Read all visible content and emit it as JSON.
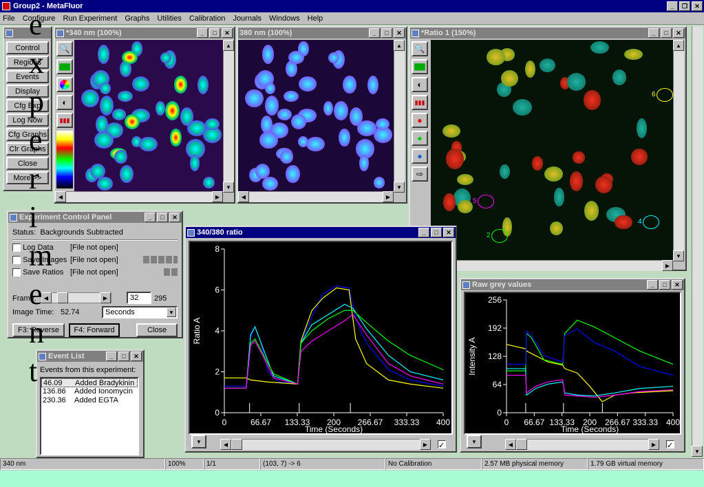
{
  "app": {
    "title": "Group2 - MetaFluor"
  },
  "menu": [
    "File",
    "Configure",
    "Run Experiment",
    "Graphs",
    "Utilities",
    "Calibration",
    "Journals",
    "Windows",
    "Help"
  ],
  "sidebar": {
    "buttons": [
      "Control",
      "Regions",
      "Events",
      "Display",
      "Cfg Exp",
      "Log Now",
      "Cfg Graphs",
      "Clr Graphs",
      "Close",
      "More >>"
    ]
  },
  "img340": {
    "title": "*340 nm (100%)"
  },
  "img380": {
    "title": "380 nm (100%)"
  },
  "ratio": {
    "title": "*Ratio 1 (150%)",
    "regions": [
      "6",
      "5",
      "2",
      "4"
    ]
  },
  "ecp": {
    "title": "Experiment Control Panel",
    "status_label": "Status:",
    "status_value": "Backgrounds Subtracted",
    "log_data": "Log Data",
    "save_images": "Save Images",
    "save_ratios": "Save Ratios",
    "file_not_open": "[File not open]",
    "frame_label": "Frame:",
    "frame_value": "32",
    "frame_total": "295",
    "image_time_label": "Image Time:",
    "image_time_value": "52.74",
    "units": "Seconds",
    "reverse": "F3: Reverse",
    "forward": "F4: Forward",
    "close": "Close"
  },
  "events": {
    "title": "Event List",
    "header": "Events from this experiment:",
    "items": [
      {
        "t": "46.09",
        "label": "Added Bradykinin"
      },
      {
        "t": "136.86",
        "label": "Added Ionomycin"
      },
      {
        "t": "230.36",
        "label": "Added EGTA"
      }
    ]
  },
  "overlay_letters": [
    "e",
    "x",
    "p",
    "e",
    "r",
    "i",
    "m",
    "e",
    "n",
    "t"
  ],
  "status": {
    "wavelength": "340 nm",
    "zoom": "100%",
    "page": "1/1",
    "coord": "(103, 7) -> 6",
    "calibration": "No Calibration",
    "physical": "2.57 MB physical memory",
    "virtual": "1.79 GB virtual memory"
  },
  "chart_data": [
    {
      "type": "line",
      "title": "340/380 ratio",
      "xlabel": "Time (Seconds)",
      "ylabel": "Ratio A",
      "xlim": [
        0,
        400
      ],
      "ylim": [
        0,
        8
      ],
      "xticks": [
        "0",
        "66.67",
        "133.33",
        "200",
        "266.67",
        "333.33",
        "400"
      ],
      "yticks": [
        "0",
        "2",
        "4",
        "6",
        "8"
      ],
      "event_times": [
        46.09,
        136.86,
        230.36
      ],
      "series": [
        {
          "color": "#0000ff",
          "points": [
            [
              0,
              1.3
            ],
            [
              40,
              1.3
            ],
            [
              48,
              3.7
            ],
            [
              56,
              4.2
            ],
            [
              66,
              3.5
            ],
            [
              80,
              2.0
            ],
            [
              100,
              1.5
            ],
            [
              134,
              1.4
            ],
            [
              140,
              3.4
            ],
            [
              160,
              4.7
            ],
            [
              180,
              5.8
            ],
            [
              205,
              6.2
            ],
            [
              228,
              6.1
            ],
            [
              240,
              4.6
            ],
            [
              260,
              3.4
            ],
            [
              300,
              2.1
            ],
            [
              340,
              1.6
            ],
            [
              400,
              1.3
            ]
          ]
        },
        {
          "color": "#ffff00",
          "points": [
            [
              0,
              1.7
            ],
            [
              40,
              1.7
            ],
            [
              48,
              1.6
            ],
            [
              80,
              1.5
            ],
            [
              134,
              1.4
            ],
            [
              140,
              3.5
            ],
            [
              160,
              5.0
            ],
            [
              180,
              5.6
            ],
            [
              205,
              6.1
            ],
            [
              228,
              6.0
            ],
            [
              240,
              3.6
            ],
            [
              260,
              2.4
            ],
            [
              300,
              1.6
            ],
            [
              340,
              1.4
            ],
            [
              400,
              1.2
            ]
          ]
        },
        {
          "color": "#00ffff",
          "points": [
            [
              0,
              1.2
            ],
            [
              40,
              1.2
            ],
            [
              48,
              3.8
            ],
            [
              56,
              4.2
            ],
            [
              70,
              3.2
            ],
            [
              90,
              1.8
            ],
            [
              134,
              1.4
            ],
            [
              140,
              3.4
            ],
            [
              160,
              4.3
            ],
            [
              190,
              4.8
            ],
            [
              220,
              5.3
            ],
            [
              235,
              5.1
            ],
            [
              260,
              4.1
            ],
            [
              300,
              2.8
            ],
            [
              340,
              2.0
            ],
            [
              400,
              1.6
            ]
          ]
        },
        {
          "color": "#00ff00",
          "points": [
            [
              0,
              1.2
            ],
            [
              40,
              1.2
            ],
            [
              48,
              3.4
            ],
            [
              56,
              3.6
            ],
            [
              70,
              2.9
            ],
            [
              90,
              1.9
            ],
            [
              134,
              1.4
            ],
            [
              140,
              3.4
            ],
            [
              160,
              4.0
            ],
            [
              190,
              4.6
            ],
            [
              220,
              5.0
            ],
            [
              235,
              5.0
            ],
            [
              260,
              4.4
            ],
            [
              300,
              3.5
            ],
            [
              340,
              2.8
            ],
            [
              400,
              2.1
            ]
          ]
        },
        {
          "color": "#ff00ff",
          "points": [
            [
              0,
              1.2
            ],
            [
              40,
              1.2
            ],
            [
              48,
              3.3
            ],
            [
              56,
              3.5
            ],
            [
              70,
              2.8
            ],
            [
              90,
              1.7
            ],
            [
              134,
              1.4
            ],
            [
              140,
              3.0
            ],
            [
              160,
              3.5
            ],
            [
              190,
              4.0
            ],
            [
              220,
              4.5
            ],
            [
              235,
              4.8
            ],
            [
              260,
              3.8
            ],
            [
              300,
              2.4
            ],
            [
              340,
              1.8
            ],
            [
              400,
              1.4
            ]
          ]
        }
      ]
    },
    {
      "type": "line",
      "title": "Raw grey values",
      "xlabel": "Time (Seconds)",
      "ylabel": "Intensity A",
      "xlim": [
        0,
        400
      ],
      "ylim": [
        0,
        256
      ],
      "xticks": [
        "0",
        "66.67",
        "133.33",
        "200",
        "266.67",
        "333.33",
        "400"
      ],
      "yticks": [
        "0",
        "64",
        "128",
        "192",
        "256"
      ],
      "event_times": [
        46.09,
        136.86,
        230.36
      ],
      "series": [
        {
          "color": "#ffff00",
          "points": [
            [
              0,
              155
            ],
            [
              46,
              145
            ],
            [
              48,
              140
            ],
            [
              100,
              115
            ],
            [
              135,
              108
            ],
            [
              140,
              100
            ],
            [
              170,
              90
            ],
            [
              200,
              60
            ],
            [
              230,
              25
            ],
            [
              260,
              40
            ],
            [
              300,
              45
            ],
            [
              400,
              50
            ]
          ]
        },
        {
          "color": "#00ff00",
          "points": [
            [
              0,
              95
            ],
            [
              46,
              95
            ],
            [
              48,
              180
            ],
            [
              60,
              170
            ],
            [
              90,
              120
            ],
            [
              135,
              110
            ],
            [
              140,
              180
            ],
            [
              170,
              210
            ],
            [
              210,
              195
            ],
            [
              260,
              170
            ],
            [
              320,
              140
            ],
            [
              400,
              110
            ]
          ]
        },
        {
          "color": "#0000ff",
          "points": [
            [
              0,
              110
            ],
            [
              46,
              110
            ],
            [
              48,
              185
            ],
            [
              60,
              175
            ],
            [
              90,
              130
            ],
            [
              135,
              115
            ],
            [
              140,
              175
            ],
            [
              170,
              190
            ],
            [
              210,
              160
            ],
            [
              260,
              140
            ],
            [
              320,
              105
            ],
            [
              400,
              85
            ]
          ]
        },
        {
          "color": "#00ffff",
          "points": [
            [
              0,
              100
            ],
            [
              46,
              100
            ],
            [
              48,
              40
            ],
            [
              70,
              55
            ],
            [
              100,
              65
            ],
            [
              135,
              70
            ],
            [
              140,
              45
            ],
            [
              170,
              40
            ],
            [
              210,
              38
            ],
            [
              260,
              45
            ],
            [
              320,
              55
            ],
            [
              400,
              60
            ]
          ]
        },
        {
          "color": "#ff00ff",
          "points": [
            [
              0,
              85
            ],
            [
              46,
              85
            ],
            [
              48,
              45
            ],
            [
              70,
              60
            ],
            [
              100,
              70
            ],
            [
              135,
              75
            ],
            [
              140,
              40
            ],
            [
              170,
              38
            ],
            [
              210,
              35
            ],
            [
              260,
              40
            ],
            [
              320,
              48
            ],
            [
              400,
              52
            ]
          ]
        }
      ]
    }
  ]
}
